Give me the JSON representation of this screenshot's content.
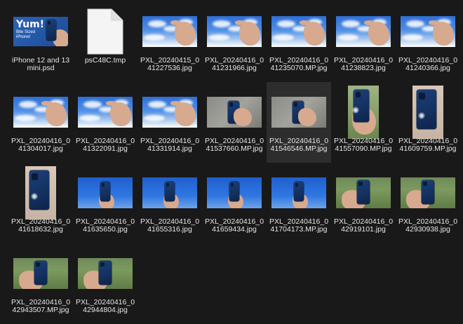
{
  "files": [
    {
      "name": "iPhone 12 and 13 mini.psd",
      "kind": "psd",
      "psd_title": "Yum!",
      "psd_subtitle": "Bite Sized iPhone!"
    },
    {
      "name": "psC48C.tmp",
      "kind": "tmp",
      "icon": "document-icon"
    },
    {
      "name": "PXL_20240415_041227536.jpg",
      "kind": "sky"
    },
    {
      "name": "PXL_20240416_041231966.jpg",
      "kind": "sky"
    },
    {
      "name": "PXL_20240416_041235070.MP.jpg",
      "kind": "sky"
    },
    {
      "name": "PXL_20240416_041238823.jpg",
      "kind": "sky"
    },
    {
      "name": "PXL_20240416_041240366.jpg",
      "kind": "sky"
    },
    {
      "name": "PXL_20240416_041304017.jpg",
      "kind": "sky"
    },
    {
      "name": "PXL_20240416_041322091.jpg",
      "kind": "sky"
    },
    {
      "name": "PXL_20240416_041331914.jpg",
      "kind": "sky"
    },
    {
      "name": "PXL_20240416_041537660.MP.jpg",
      "kind": "pave"
    },
    {
      "name": "PXL_20240416_041546546.MP.jpg",
      "kind": "pave",
      "selected": true
    },
    {
      "name": "PXL_20240416_041557090.MP.jpg",
      "kind": "tallgrass"
    },
    {
      "name": "PXL_20240416_041609759.MP.jpg",
      "kind": "tallhand"
    },
    {
      "name": "PXL_20240416_041618632.jpg",
      "kind": "tallhand"
    },
    {
      "name": "PXL_20240416_041635650.jpg",
      "kind": "skyphone"
    },
    {
      "name": "PXL_20240416_041655316.jpg",
      "kind": "skyphone"
    },
    {
      "name": "PXL_20240416_041659434.jpg",
      "kind": "skyphone"
    },
    {
      "name": "PXL_20240416_041704173.MP.jpg",
      "kind": "skyphone"
    },
    {
      "name": "PXL_20240416_042919101.jpg",
      "kind": "grass"
    },
    {
      "name": "PXL_20240416_042930938.jpg",
      "kind": "grass"
    },
    {
      "name": "PXL_20240416_042943507.MP.jpg",
      "kind": "grass"
    },
    {
      "name": "PXL_20240416_042944804.jpg",
      "kind": "grass"
    }
  ]
}
